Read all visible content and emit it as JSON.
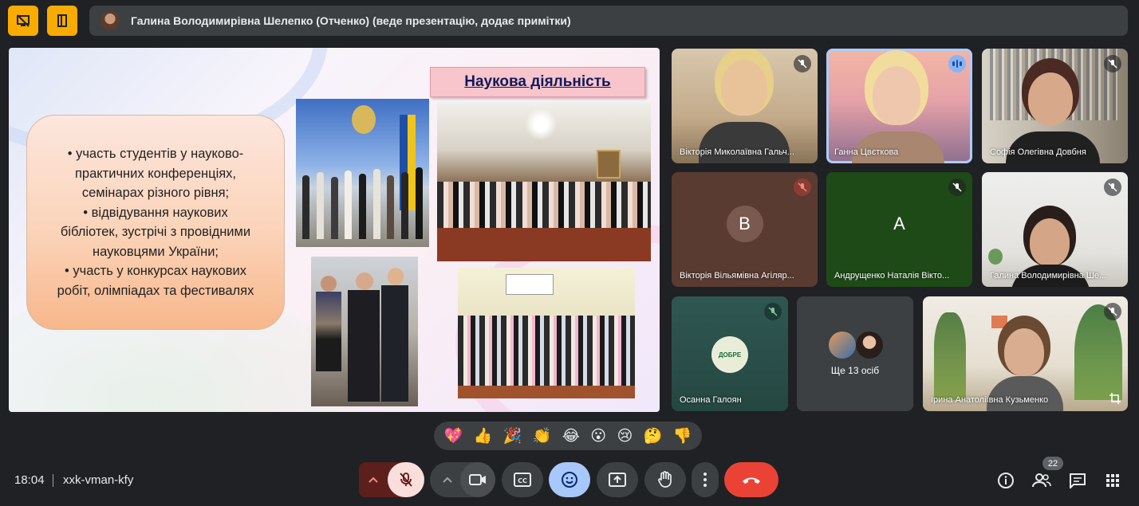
{
  "topbar": {
    "presenter_text": "Галина Володимирівна Шелепко (Отченко) (веде презентацію, додає примітки)"
  },
  "slide": {
    "title": "Наукова діяльність",
    "bullets": [
      "• участь студентів у науково-",
      "практичних конференціях,",
      "семінарах різного рівня;",
      "• відвідування наукових",
      "бібліотек, зустрічі з провідними",
      "науковцями України;",
      "• участь у конкурсах наукових",
      "робіт, олімпіадах та фестивалях"
    ]
  },
  "participants": [
    {
      "name": "Вікторія Миколаївна Гальч...",
      "state": "muted"
    },
    {
      "name": "Ганна Цвєткова",
      "state": "speaking"
    },
    {
      "name": "Софія Олегівна Довбня",
      "state": "muted"
    },
    {
      "name": "Вікторія Вільямівна Агіляр...",
      "state": "muted",
      "initial": "В",
      "color": "#6b4a3d"
    },
    {
      "name": "Андрущенко Наталія Вікто...",
      "state": "muted",
      "initial": "А",
      "color": "#2e5d22"
    },
    {
      "name": "Галина Володимирівна Ше...",
      "state": "muted"
    },
    {
      "name": "Осанна Галоян",
      "state": "muted",
      "logo_text": "ДОБРЕ"
    },
    {
      "name": "Ірина Анатоліївна Кузьменко",
      "state": "muted"
    }
  ],
  "others_tile": {
    "label": "Ще 13 осіб"
  },
  "reactions": [
    "💖",
    "👍",
    "🎉",
    "👏",
    "😂",
    "😮",
    "😢",
    "🤔",
    "👎"
  ],
  "bottombar": {
    "time": "18:04",
    "meeting_code": "xxk-vman-kfy",
    "participants_count": "22"
  },
  "colors": {
    "accent_yellow": "#f9ab00",
    "end_call_red": "#ea4335",
    "mic_muted_bg": "#f9dedc",
    "emoji_active_bg": "#a8c7fa"
  }
}
